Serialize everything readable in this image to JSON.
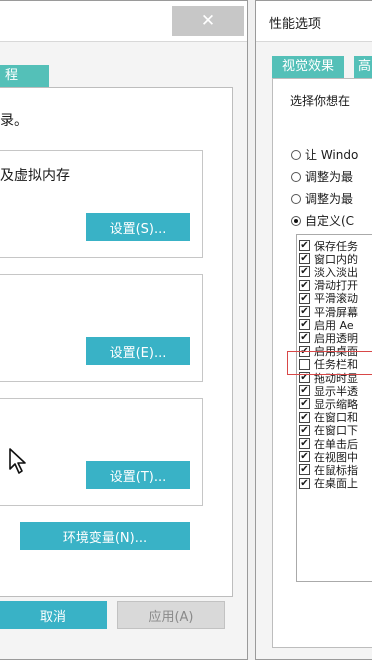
{
  "left_dialog": {
    "close_glyph": "✕",
    "tab_label": "程",
    "text_line1": "录。",
    "text_line2": "及虚拟内存",
    "settings_perf": "设置(S)...",
    "settings_profile": "设置(E)...",
    "settings_startup": "设置(T)...",
    "env_vars": "环境变量(N)...",
    "cancel": "取消",
    "apply": "应用(A)"
  },
  "perf_dialog": {
    "title": "性能选项",
    "tab_visual": "视觉效果",
    "tab_advanced": "高",
    "prompt": "选择你想在",
    "radios": [
      {
        "label": "让 Windo",
        "selected": false
      },
      {
        "label": "调整为最",
        "selected": false
      },
      {
        "label": "调整为最",
        "selected": false
      },
      {
        "label": "自定义(C",
        "selected": true
      }
    ],
    "effects": [
      {
        "label": "保存任务",
        "checked": true
      },
      {
        "label": "窗口内的",
        "checked": true
      },
      {
        "label": "淡入淡出",
        "checked": true
      },
      {
        "label": "滑动打开",
        "checked": true
      },
      {
        "label": "平滑滚动",
        "checked": true
      },
      {
        "label": "平滑屏幕",
        "checked": true
      },
      {
        "label": "启用 Ae",
        "checked": true
      },
      {
        "label": "启用透明",
        "checked": true
      },
      {
        "label": "启用桌面",
        "checked": true
      },
      {
        "label": "任务栏和",
        "checked": false
      },
      {
        "label": "拖动时显",
        "checked": true
      },
      {
        "label": "显示半透",
        "checked": true
      },
      {
        "label": "显示缩略",
        "checked": true
      },
      {
        "label": "在窗口和",
        "checked": true
      },
      {
        "label": "在窗口下",
        "checked": true
      },
      {
        "label": "在单击后",
        "checked": true
      },
      {
        "label": "在视图中",
        "checked": true
      },
      {
        "label": "在鼠标指",
        "checked": true
      },
      {
        "label": "在桌面上",
        "checked": true
      }
    ],
    "check_glyph": "✔"
  },
  "colors": {
    "accent": "#39b2c6",
    "tab": "#54c0b8",
    "highlight": "#d84848"
  }
}
